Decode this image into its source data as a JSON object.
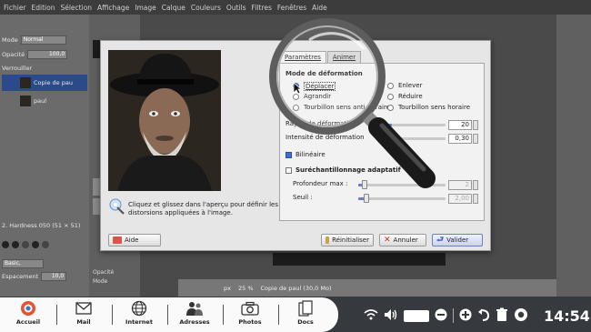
{
  "gimp": {
    "menu": [
      "Fichier",
      "Edition",
      "Sélection",
      "Affichage",
      "Image",
      "Calque",
      "Couleurs",
      "Outils",
      "Filtres",
      "Fenêtres",
      "Aide"
    ],
    "layers": {
      "mode_label": "Mode",
      "mode_value": "Normal",
      "opacity_label": "Opacité",
      "opacity_value": "100,0",
      "lock_label": "Verrouiller",
      "layer1": "Copie de pau",
      "layer2": "paul"
    },
    "brushes": {
      "size_label": "2. Hardness 050 (51 × 51)",
      "preset": "Basic,",
      "spacing_label": "Espacement",
      "spacing_value": "10,0"
    },
    "tool_options": {
      "mode_label": "Mode",
      "opacity_label": "Opacité"
    },
    "statusbar": {
      "unit": "px",
      "zoom": "25 %",
      "layer": "Copie de paul (30,0 Mo)"
    }
  },
  "dialog": {
    "tabs": [
      "Paramètres",
      "Animer"
    ],
    "mode_title": "Mode de déformation",
    "modes": {
      "move": "Déplacer",
      "grow": "Agrandir",
      "ccw": "Tourbillon sens anti-horaire",
      "remove": "Enlever",
      "shrink": "Réduire",
      "cw": "Tourbillon sens horaire"
    },
    "radius_label": "Rayon de déformation",
    "radius_value": "20",
    "amount_label": "Intensité de déformation",
    "amount_value": "0,30",
    "bilinear_label": "Bilinéaire",
    "supersample_label": "Suréchantillonnage adaptatif",
    "depth_label": "Profondeur max :",
    "depth_value": "2",
    "threshold_label": "Seuil :",
    "threshold_value": "2,00",
    "hint": "Cliquez et glissez dans l'aperçu pour définir les distorsions appliquées à l'image.",
    "buttons": {
      "help": "Aide",
      "reset": "Réinitialiser",
      "cancel": "Annuler",
      "ok": "Valider"
    }
  },
  "taskbar": {
    "items": [
      "Accueil",
      "Mail",
      "Internet",
      "Adresses",
      "Photos",
      "Docs"
    ],
    "clock": "14:54"
  }
}
